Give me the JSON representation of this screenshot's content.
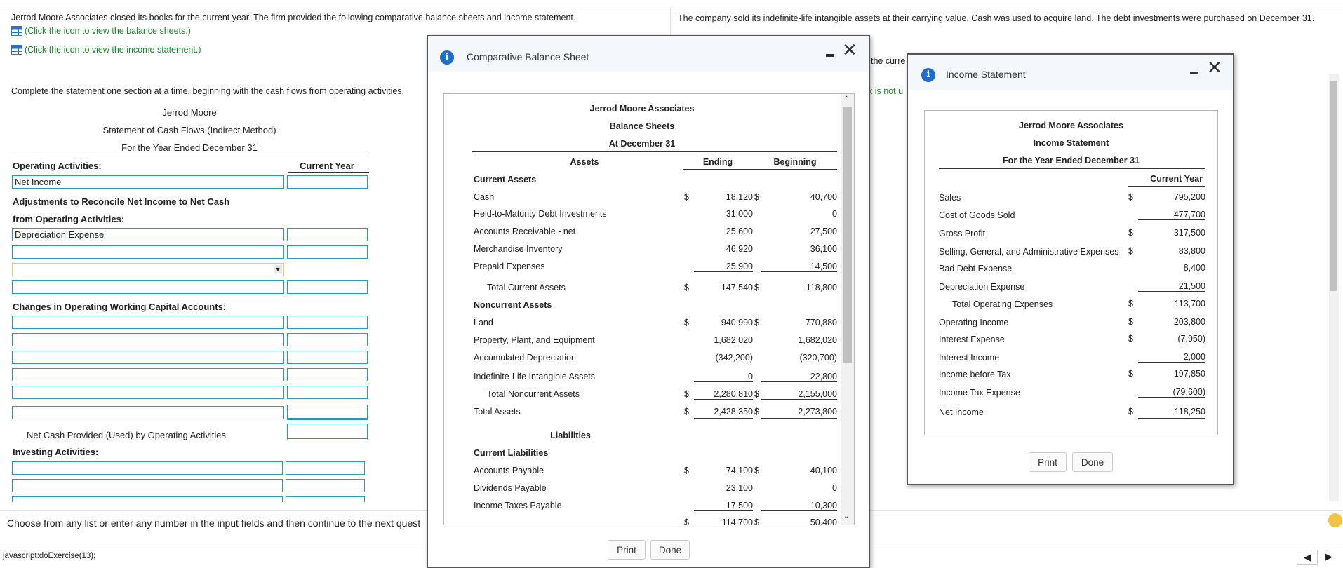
{
  "intro": {
    "text": "Jerrod Moore Associates closed its books for the current year. The firm provided the following comparative balance sheets and income statement.",
    "link_balance": "(Click the icon to view the balance sheets.)",
    "link_income": "(Click the icon to view the income statement.)",
    "right_text": "The company sold its indefinite-life intangible assets at their carrying value. Cash was used to acquire land. The debt investments were purchased on December 31.",
    "right_fragment1": "the curre",
    "right_fragment2": "k is not u"
  },
  "instruction": "Complete the statement one section at a time, beginning with the cash flows from operating activities.",
  "worksheet": {
    "company": "Jerrod Moore",
    "title": "Statement of Cash Flows (Indirect Method)",
    "period": "For the Year Ended December 31",
    "op_header": "Operating Activities:",
    "col_header": "Current Year",
    "net_income": "Net Income",
    "adj_line1": "Adjustments to Reconcile Net Income to Net Cash",
    "adj_line2": "from Operating Activities:",
    "depreciation": "Depreciation Expense",
    "dropdown_arrow": "▼",
    "changes_header": "Changes in Operating Working Capital Accounts:",
    "net_cash_op": "Net Cash Provided (Used) by Operating Activities",
    "inv_header": "Investing Activities:"
  },
  "footer_note": "Choose from any list or enter any number in the input fields and then continue to the next quest",
  "status_text": "javascript:doExercise(13);",
  "balance_sheet": {
    "dialog_title": "Comparative Balance Sheet",
    "company": "Jerrod Moore Associates",
    "title": "Balance Sheets",
    "date": "At December 31",
    "col_assets": "Assets",
    "col_ending": "Ending",
    "col_beginning": "Beginning",
    "current_assets": "Current Assets",
    "rows_ca": [
      {
        "label": "Cash",
        "d1": "$",
        "end": "18,120",
        "d2": "$",
        "beg": "40,700"
      },
      {
        "label": "Held-to-Maturity Debt Investments",
        "d1": "",
        "end": "31,000",
        "d2": "",
        "beg": "0"
      },
      {
        "label": "Accounts Receivable - net",
        "d1": "",
        "end": "25,600",
        "d2": "",
        "beg": "27,500"
      },
      {
        "label": "Merchandise Inventory",
        "d1": "",
        "end": "46,920",
        "d2": "",
        "beg": "36,100"
      },
      {
        "label": "Prepaid Expenses",
        "d1": "",
        "end": "25,900",
        "d2": "",
        "beg": "14,500"
      }
    ],
    "total_ca": {
      "label": "Total Current Assets",
      "d1": "$",
      "end": "147,540",
      "d2": "$",
      "beg": "118,800"
    },
    "noncurrent_assets": "Noncurrent Assets",
    "rows_nca": [
      {
        "label": "Land",
        "d1": "$",
        "end": "940,990",
        "d2": "$",
        "beg": "770,880"
      },
      {
        "label": "Property, Plant, and Equipment",
        "d1": "",
        "end": "1,682,020",
        "d2": "",
        "beg": "1,682,020"
      },
      {
        "label": "Accumulated Depreciation",
        "d1": "",
        "end": "(342,200)",
        "d2": "",
        "beg": "(320,700)"
      },
      {
        "label": "Indefinite-Life Intangible Assets",
        "d1": "",
        "end": "0",
        "d2": "",
        "beg": "22,800"
      }
    ],
    "total_nca": {
      "label": "Total Noncurrent Assets",
      "d1": "$",
      "end": "2,280,810",
      "d2": "$",
      "beg": "2,155,000"
    },
    "total_assets": {
      "label": "Total Assets",
      "d1": "$",
      "end": "2,428,350",
      "d2": "$",
      "beg": "2,273,800"
    },
    "liabilities": "Liabilities",
    "current_liabilities": "Current Liabilities",
    "rows_cl": [
      {
        "label": "Accounts Payable",
        "d1": "$",
        "end": "74,100",
        "d2": "$",
        "beg": "40,100"
      },
      {
        "label": "Dividends Payable",
        "d1": "",
        "end": "23,100",
        "d2": "",
        "beg": "0"
      },
      {
        "label": "Income Taxes Payable",
        "d1": "",
        "end": "17,500",
        "d2": "",
        "beg": "10,300"
      }
    ],
    "partial_row": {
      "d1": "$",
      "end": "114,700",
      "d2": "$",
      "beg": "50,400"
    },
    "print": "Print",
    "done": "Done"
  },
  "income_statement": {
    "dialog_title": "Income Statement",
    "company": "Jerrod Moore Associates",
    "title": "Income Statement",
    "period": "For the Year Ended December 31",
    "col": "Current Year",
    "rows": [
      {
        "label": "Sales",
        "d": "$",
        "val": "795,200"
      },
      {
        "label": "Cost of Goods Sold",
        "d": "",
        "val": "477,700"
      },
      {
        "label": "Gross Profit",
        "d": "$",
        "val": "317,500"
      },
      {
        "label": "Selling, General, and Administrative Expenses",
        "d": "$",
        "val": "83,800"
      },
      {
        "label": "Bad Debt Expense",
        "d": "",
        "val": "8,400"
      },
      {
        "label": "Depreciation Expense",
        "d": "",
        "val": "21,500"
      },
      {
        "label": "Total Operating Expenses",
        "d": "$",
        "val": "113,700"
      },
      {
        "label": "Operating Income",
        "d": "$",
        "val": "203,800"
      },
      {
        "label": "Interest Expense",
        "d": "$",
        "val": "(7,950)"
      },
      {
        "label": "Interest Income",
        "d": "",
        "val": "2,000"
      },
      {
        "label": "Income before Tax",
        "d": "$",
        "val": "197,850"
      },
      {
        "label": "Income Tax Expense",
        "d": "",
        "val": "(79,600)"
      },
      {
        "label": "Net Income",
        "d": "$",
        "val": "118,250"
      }
    ],
    "print": "Print",
    "done": "Done"
  },
  "colors": {
    "input_border": "#2a9bb5",
    "link": "#1a8a2a",
    "info": "#1a6fd0",
    "highlight": "#f0cf4a"
  },
  "nav": {
    "prev": "◀",
    "next": "▶"
  }
}
